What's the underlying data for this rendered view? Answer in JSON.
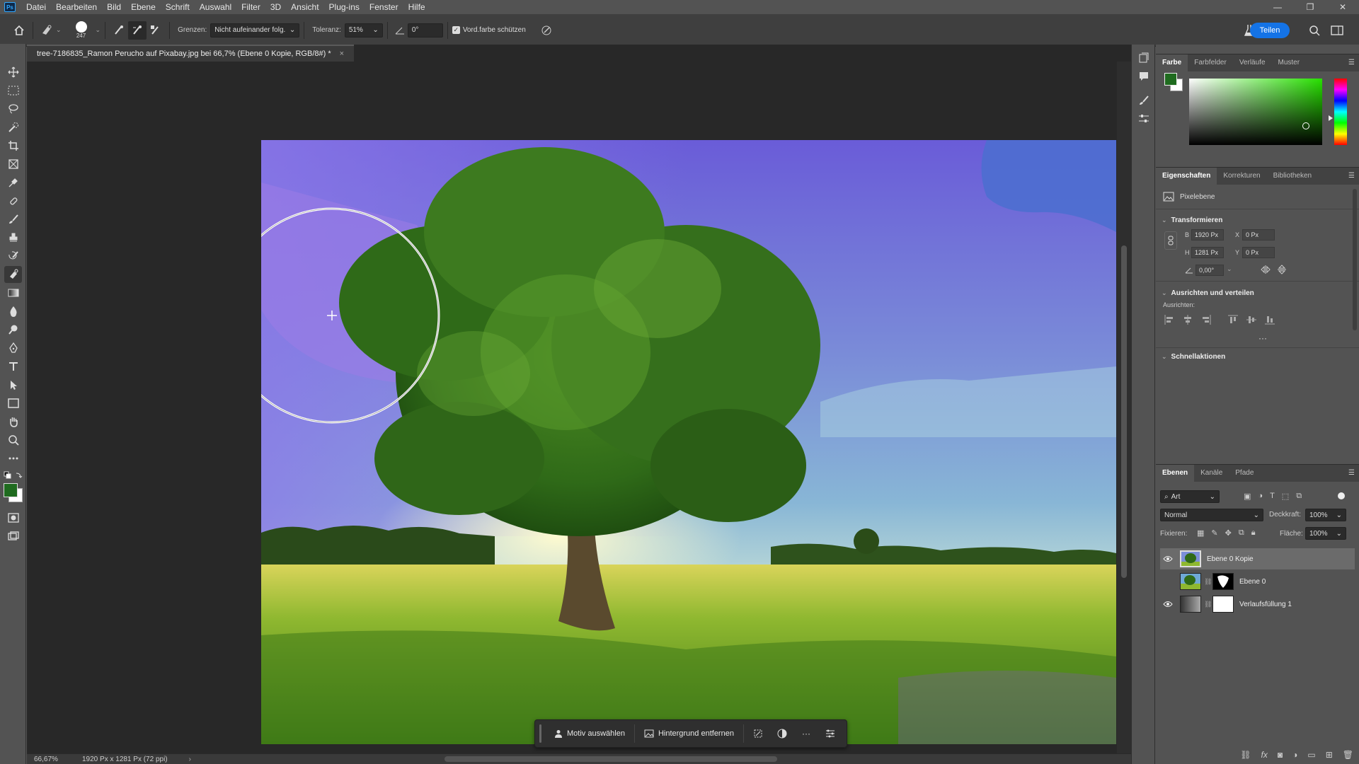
{
  "menubar": {
    "app_icon": "Ps",
    "items": [
      "Datei",
      "Bearbeiten",
      "Bild",
      "Ebene",
      "Schrift",
      "Auswahl",
      "Filter",
      "3D",
      "Ansicht",
      "Plug-ins",
      "Fenster",
      "Hilfe"
    ],
    "window_controls": {
      "minimize": "—",
      "restore": "❐",
      "close": "✕"
    }
  },
  "options": {
    "brush_size": "247",
    "limits_label": "Grenzen:",
    "limits_value": "Nicht aufeinander folg.",
    "tolerance_label": "Toleranz:",
    "tolerance_value": "51%",
    "angle_value": "0°",
    "protect_fg_label": "Vord.farbe schützen",
    "protect_fg_checked": true,
    "share_label": "Teilen"
  },
  "document": {
    "tab_title": "tree-7186835_Ramon Perucho auf Pixabay.jpg bei 66,7% (Ebene 0 Kopie, RGB/8#) *",
    "close": "×"
  },
  "taskbar": {
    "select_subject": "Motiv auswählen",
    "remove_background": "Hintergrund entfernen",
    "more": "···"
  },
  "status": {
    "zoom": "66,67%",
    "dimensions": "1920 Px x 1281 Px (72 ppi)",
    "arrow": "›"
  },
  "colors": {
    "foreground": "#1f6b1f",
    "background": "#ffffff",
    "accent_blue": "#1473e6"
  },
  "color_panel": {
    "tabs": [
      "Farbe",
      "Farbfelder",
      "Verläufe",
      "Muster"
    ]
  },
  "properties_panel": {
    "tabs": [
      "Eigenschaften",
      "Korrekturen",
      "Bibliotheken"
    ],
    "layer_type": "Pixelebene",
    "transform_title": "Transformieren",
    "w_label": "B",
    "w_value": "1920 Px",
    "h_label": "H",
    "h_value": "1281 Px",
    "x_label": "X",
    "x_value": "0 Px",
    "y_label": "Y",
    "y_value": "0 Px",
    "angle_value": "0,00°",
    "align_title": "Ausrichten und verteilen",
    "align_label": "Ausrichten:",
    "more": "···",
    "quick_actions_title": "Schnellaktionen"
  },
  "layers_panel": {
    "tabs": [
      "Ebenen",
      "Kanäle",
      "Pfade"
    ],
    "filter_kind": "Art",
    "blend_mode": "Normal",
    "opacity_label": "Deckkraft:",
    "opacity_value": "100%",
    "lock_label": "Fixieren:",
    "fill_label": "Fläche:",
    "fill_value": "100%",
    "layers": [
      {
        "name": "Ebene 0 Kopie",
        "visible": true,
        "selected": true
      },
      {
        "name": "Ebene 0",
        "visible": false,
        "selected": false
      },
      {
        "name": "Verlaufsfüllung 1",
        "visible": true,
        "selected": false
      }
    ]
  }
}
